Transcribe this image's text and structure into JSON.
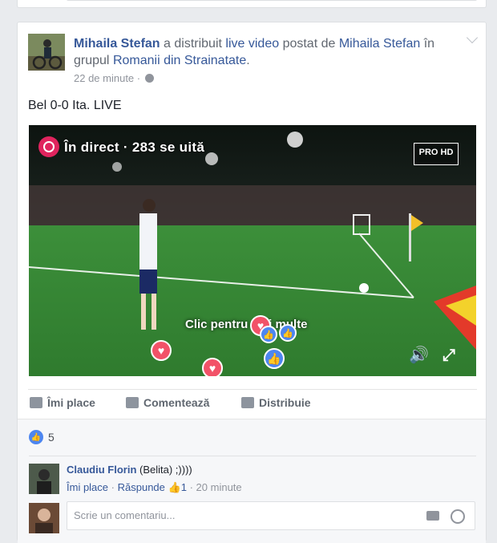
{
  "post": {
    "author": "Mihaila Stefan",
    "action_text": "a distribuit",
    "shared_object": "live video",
    "posted_by_text": "postat de",
    "original_author": "Mihaila Stefan",
    "in_text": "în",
    "group_text": "grupul",
    "group_name": "Romanii din Strainatate",
    "period": ".",
    "time": "22 de minute",
    "time_separator": "·",
    "text": "Bel 0-0 Ita. LIVE"
  },
  "video": {
    "live_label": "În direct · 283 se uită",
    "channel_logo": "PRO HD",
    "overlay_text": "Clic pentru mai multe",
    "volume_icon": "🔊",
    "fullscreen_icon": "⤢"
  },
  "actions": {
    "like": "Îmi place",
    "comment": "Comentează",
    "share": "Distribuie"
  },
  "feedback": {
    "like_count": "5",
    "comment": {
      "author": "Claudiu Florin",
      "text": "(Belita) ;))))",
      "like_link": "Îmi place",
      "reply_link": "Răspunde",
      "likes": "1",
      "time": "20 minute",
      "separator": "·"
    },
    "write_placeholder": "Scrie un comentariu..."
  },
  "colors": {
    "link": "#365899",
    "live": "#e0245e",
    "like_blue": "#4d86f0",
    "heart": "#f25268"
  }
}
